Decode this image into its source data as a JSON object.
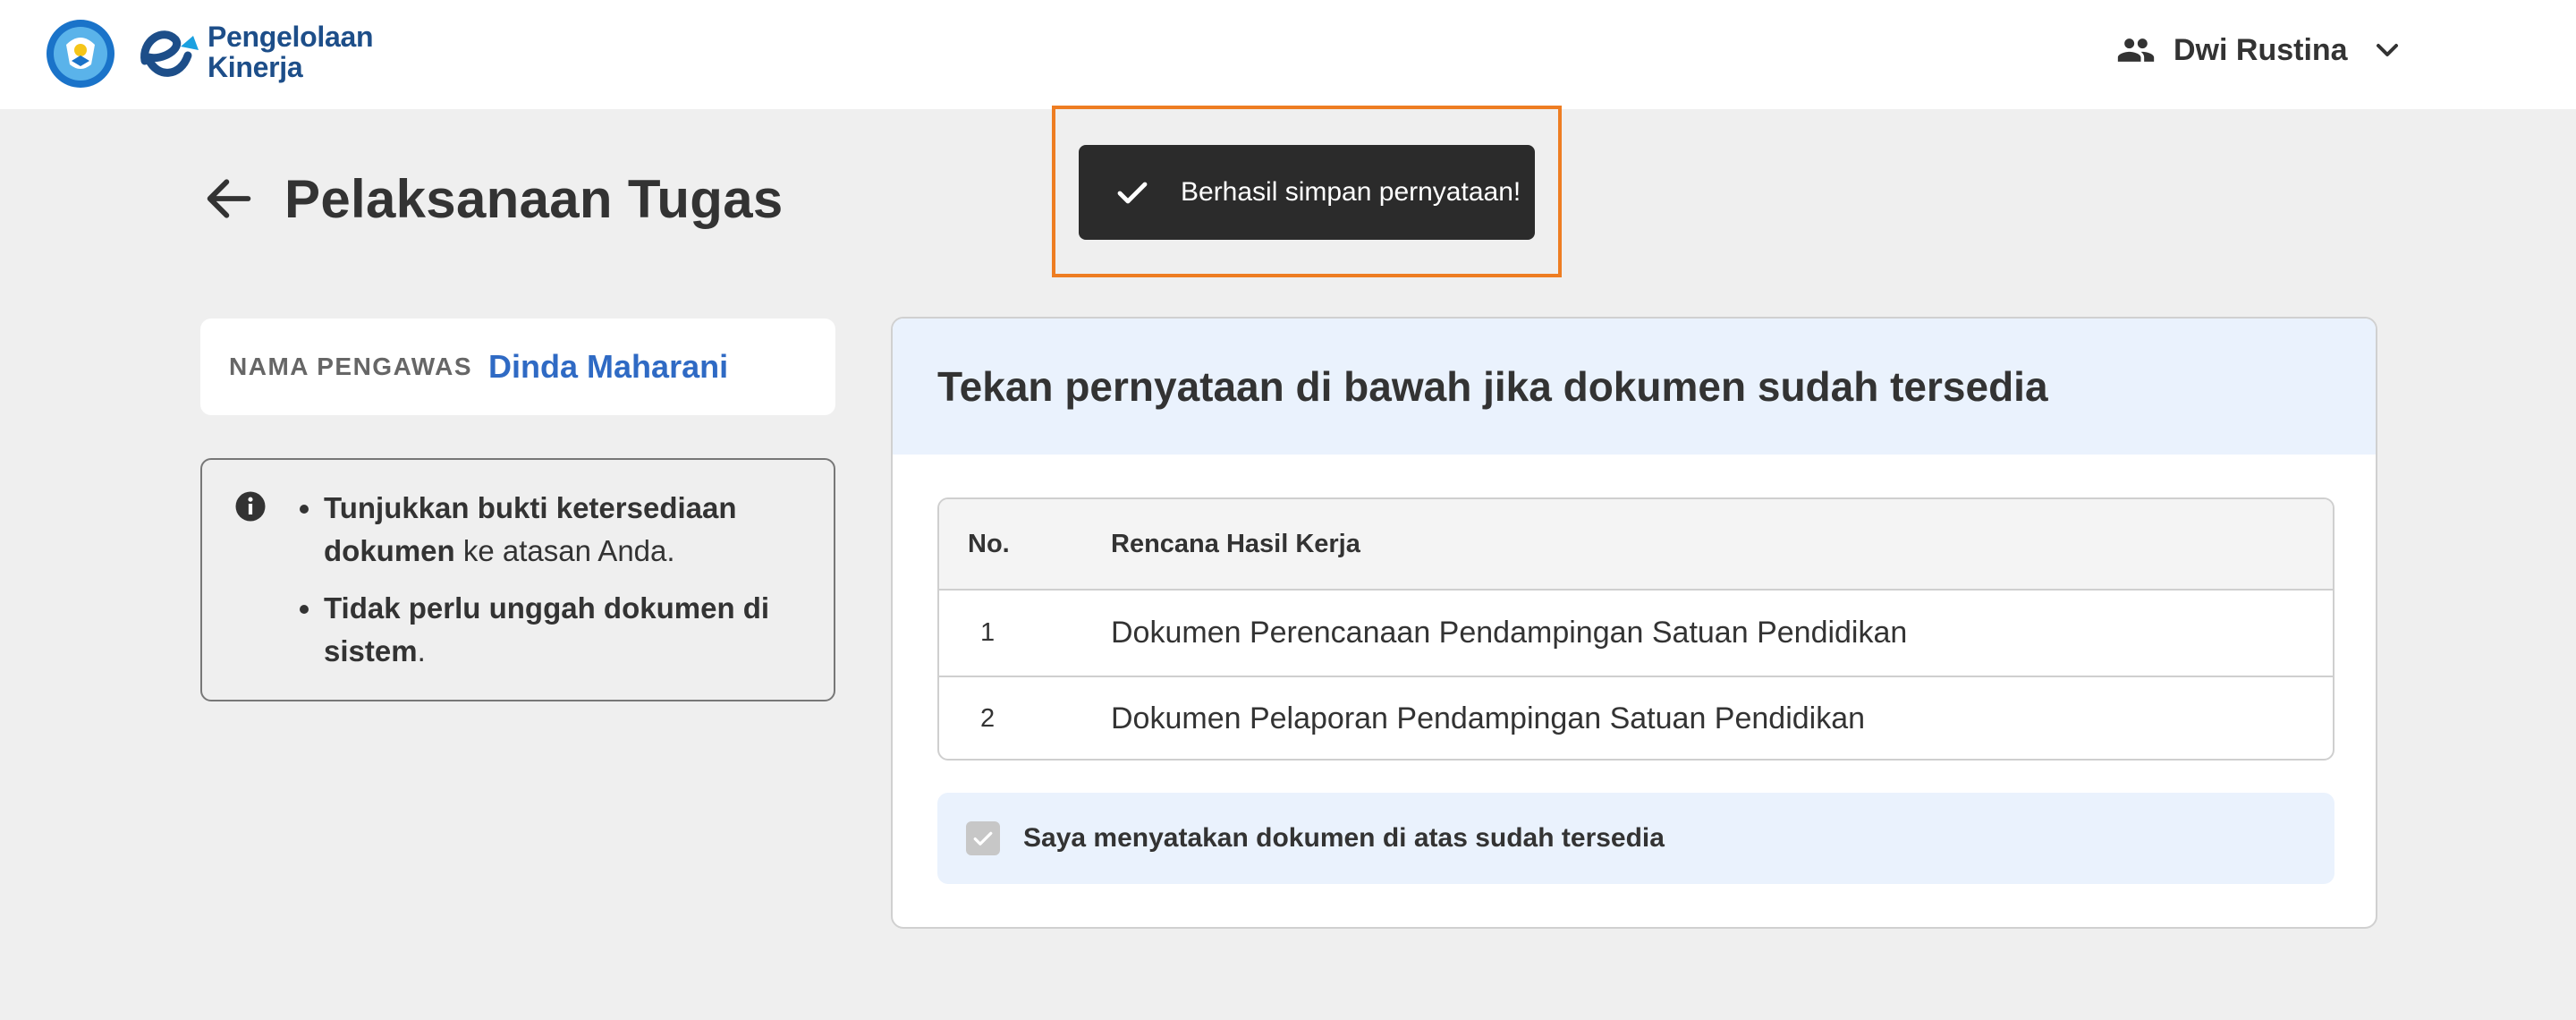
{
  "header": {
    "brand_line1": "Pengelolaan",
    "brand_line2": "Kinerja",
    "user_name": "Dwi Rustina"
  },
  "page": {
    "title": "Pelaksanaan Tugas"
  },
  "toast": {
    "message": "Berhasil simpan pernyataan!"
  },
  "supervisor": {
    "label": "NAMA PENGAWAS",
    "name": "Dinda Maharani"
  },
  "info": {
    "item1_bold": "Tunjukkan bukti ketersediaan dokumen",
    "item1_rest": " ke atasan Anda.",
    "item2_bold": "Tidak perlu unggah dokumen di sistem",
    "item2_rest": "."
  },
  "panel": {
    "heading": "Tekan pernyataan di bawah jika dokumen sudah tersedia",
    "table": {
      "columns": [
        "No.",
        "Rencana Hasil Kerja"
      ],
      "rows": [
        {
          "no": "1",
          "rhk": "Dokumen Perencanaan Pendampingan Satuan Pendidikan"
        },
        {
          "no": "2",
          "rhk": "Dokumen Pelaporan Pendampingan Satuan Pendidikan"
        }
      ]
    },
    "consent_label": "Saya menyatakan dokumen di atas sudah tersedia",
    "consent_checked": true
  },
  "colors": {
    "accent_link": "#2f6ac4",
    "brand": "#1d4e89",
    "highlight": "#ee7d22",
    "toast_bg": "#2b2b2b",
    "panel_head_bg": "#eaf2fd"
  }
}
